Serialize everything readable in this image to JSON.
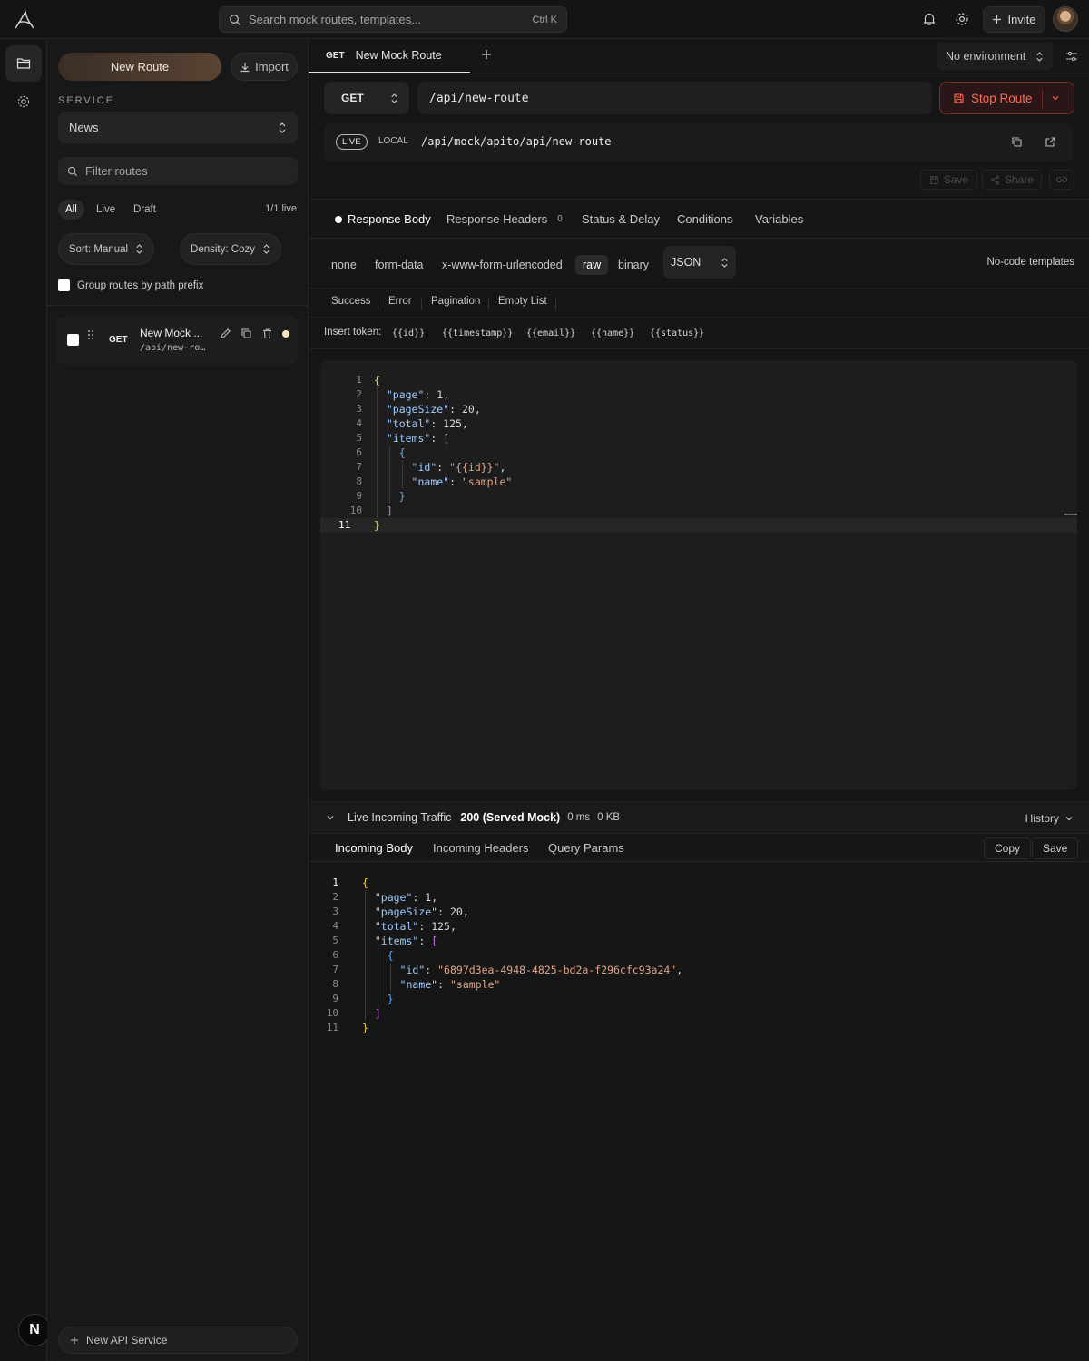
{
  "topbar": {
    "search_placeholder": "Search mock routes, templates...",
    "search_shortcut": "Ctrl K",
    "invite_label": "Invite",
    "icons": [
      "logo-icon",
      "search-icon",
      "bell-icon",
      "gear-icon",
      "plus-icon",
      "avatar"
    ]
  },
  "rail": {
    "items": [
      "folder-icon",
      "gear-icon"
    ],
    "user_initial": "N"
  },
  "sidebar": {
    "new_route_label": "New Route",
    "import_label": "Import",
    "service_label": "SERVICE",
    "service_value": "News",
    "filter_placeholder": "Filter routes",
    "filter_tabs": [
      "All",
      "Live",
      "Draft"
    ],
    "live_count": "1/1 live",
    "sort_label": "Sort: Manual",
    "density_label": "Density: Cozy",
    "group_label": "Group routes by path prefix",
    "routes": [
      {
        "method": "GET",
        "name": "New Mock ...",
        "path": "/api/new-ro…",
        "status_color": "#f5e6b8"
      }
    ],
    "new_service_label": "New API Service"
  },
  "tabs": {
    "active_method": "GET",
    "active_title": "New Mock Route",
    "environment": "No environment"
  },
  "request": {
    "method": "GET",
    "url": "/api/new-route",
    "stop_label": "Stop Route",
    "live_badge": "LIVE",
    "local_label": "LOCAL",
    "local_url": "/api/mock/apito/api/new-route",
    "save_label": "Save",
    "share_label": "Share"
  },
  "response_tabs": {
    "body": "Response Body",
    "headers": "Response Headers",
    "headers_count": "0",
    "status": "Status & Delay",
    "conditions": "Conditions",
    "variables": "Variables"
  },
  "body_types": [
    "none",
    "form-data",
    "x-www-form-urlencoded",
    "raw",
    "binary"
  ],
  "body_format": "JSON",
  "nocode_label": "No-code templates",
  "presets": [
    "Success",
    "Error",
    "Pagination",
    "Empty List"
  ],
  "insert_token_label": "Insert token:",
  "tokens": [
    "{{id}}",
    "{{timestamp}}",
    "{{email}}",
    "{{name}}",
    "{{status}}"
  ],
  "editor_lines": [
    "{",
    "  \"page\": 1,",
    "  \"pageSize\": 20,",
    "  \"total\": 125,",
    "  \"items\": [",
    "    {",
    "      \"id\": \"{{id}}\",",
    "      \"name\": \"sample\"",
    "    }",
    "  ]",
    "}"
  ],
  "traffic": {
    "title": "Live Incoming Traffic",
    "status": "200 (Served Mock)",
    "time": "0 ms",
    "size": "0 KB",
    "history_label": "History",
    "tabs": [
      "Incoming Body",
      "Incoming Headers",
      "Query Params"
    ],
    "copy_label": "Copy",
    "save_label": "Save",
    "lines": [
      "{",
      "  \"page\": 1,",
      "  \"pageSize\": 20,",
      "  \"total\": 125,",
      "  \"items\": [",
      "    {",
      "      \"id\": \"6897d3ea-4948-4825-bd2a-f296cfc93a24\",",
      "      \"name\": \"sample\"",
      "    }",
      "  ]",
      "}"
    ]
  },
  "colors": {
    "accent": "#ff6a52",
    "background": "#161616",
    "key": "#9ecbff",
    "string": "#e0a48a",
    "brace": "#f2d34b"
  }
}
